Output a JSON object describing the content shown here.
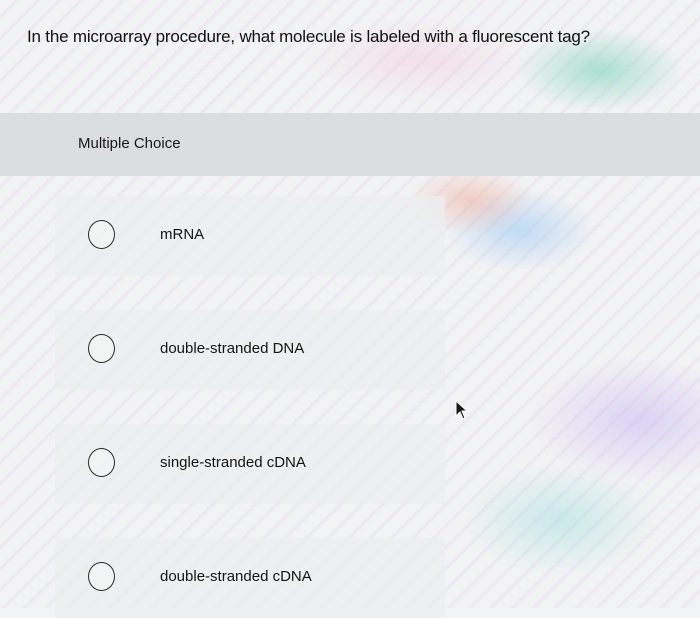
{
  "question": {
    "text": "In the microarray procedure, what molecule is labeled with a fluorescent tag?"
  },
  "section": {
    "title": "Multiple Choice"
  },
  "options": [
    {
      "label": "mRNA"
    },
    {
      "label": "double-stranded DNA"
    },
    {
      "label": "single-stranded cDNA"
    },
    {
      "label": "double-stranded cDNA"
    }
  ],
  "icons": {
    "cursor": "mouse-pointer-icon"
  }
}
